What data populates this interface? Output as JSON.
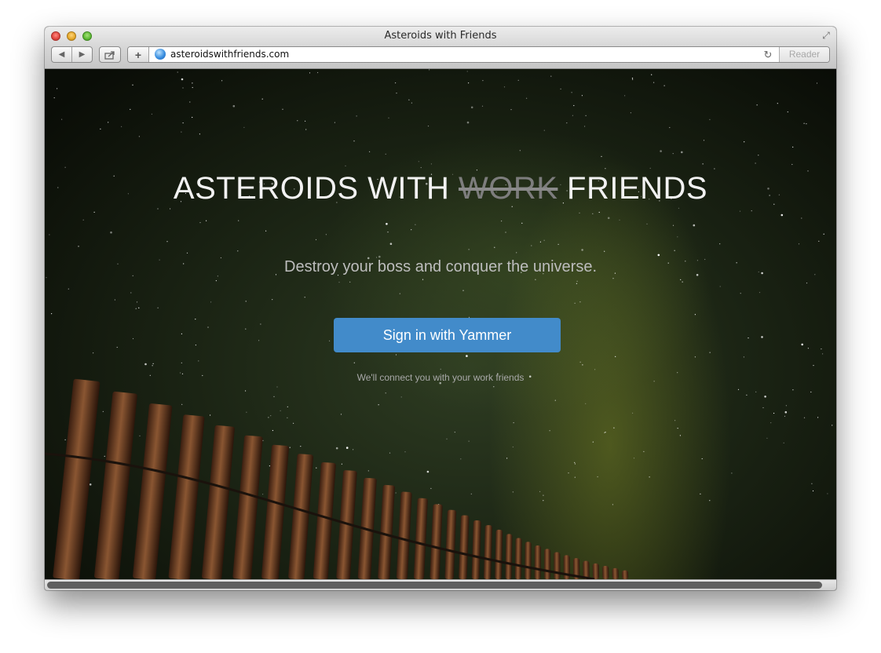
{
  "window": {
    "title": "Asteroids with Friends",
    "icons": {
      "close": "close-button",
      "minimize": "minimize-button",
      "zoom": "zoom-button",
      "fullscreen": "fullscreen-icon"
    }
  },
  "toolbar": {
    "back_glyph": "◀",
    "forward_glyph": "▶",
    "share_glyph": "⇪",
    "add_glyph": "+",
    "reload_glyph": "↻",
    "fullscreen_glyph": "⤢",
    "url": "asteroidswithfriends.com",
    "reader_label": "Reader"
  },
  "hero": {
    "title_part1": "ASTEROIDS WITH ",
    "title_strike": "WORK",
    "title_part2": " FRIENDS",
    "subtitle": "Destroy your boss and conquer the universe.",
    "signin_label": "Sign in with Yammer",
    "signin_note": "We'll connect you with your work friends"
  },
  "colors": {
    "button": "#428bca",
    "title": "#f2f2f2",
    "strike": "#7d7d7d"
  }
}
